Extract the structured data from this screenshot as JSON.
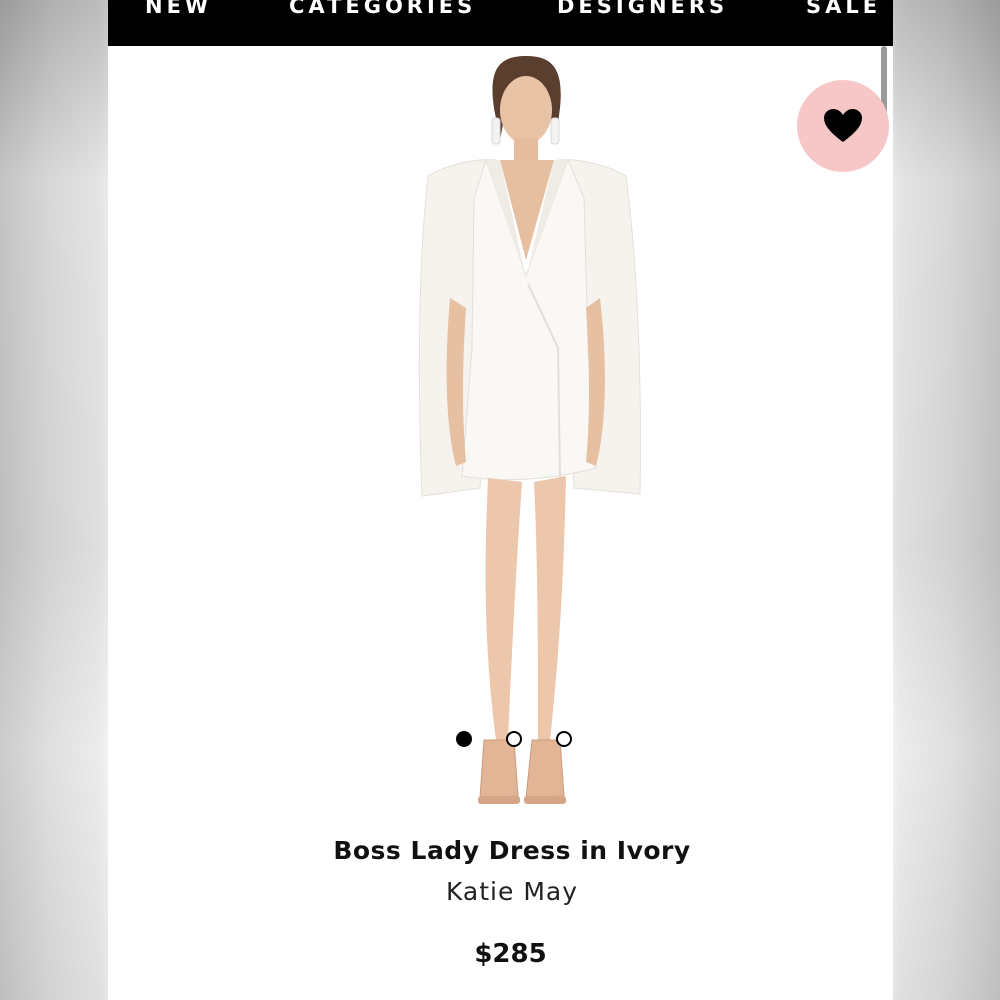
{
  "nav": {
    "items": [
      "NEW",
      "CATEGORIES",
      "DESIGNERS",
      "SALE"
    ]
  },
  "favorite": {
    "icon": "heart-icon",
    "background_color": "#f7c7c8",
    "icon_color": "#000000"
  },
  "carousel": {
    "total": 3,
    "active_index": 0
  },
  "product": {
    "title": "Boss Lady Dress in Ivory",
    "brand": "Katie May",
    "price": "$285"
  }
}
